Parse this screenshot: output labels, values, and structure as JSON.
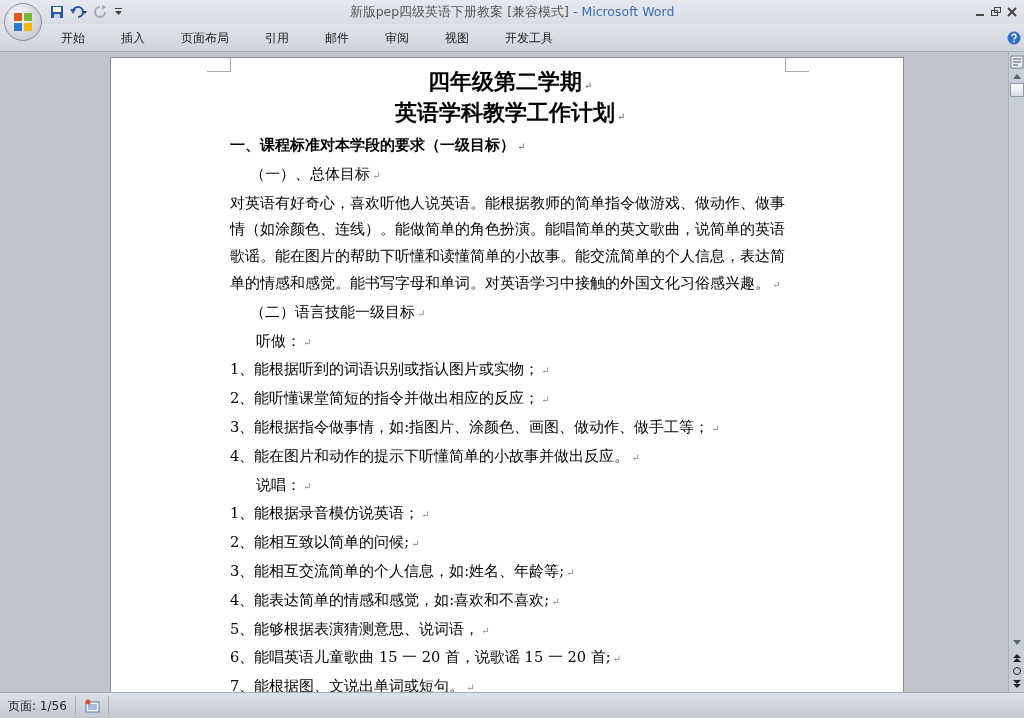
{
  "window": {
    "doc_title": "新版pep四级英语下册教案 [兼容模式]",
    "app_name": " - Microsoft Word"
  },
  "ribbon_tabs": [
    {
      "label": "开始",
      "selected": false
    },
    {
      "label": "插入",
      "selected": false
    },
    {
      "label": "页面布局",
      "selected": false
    },
    {
      "label": "引用",
      "selected": false
    },
    {
      "label": "邮件",
      "selected": false
    },
    {
      "label": "审阅",
      "selected": false
    },
    {
      "label": "视图",
      "selected": false
    },
    {
      "label": "开发工具",
      "selected": false
    }
  ],
  "document": {
    "title_lines": [
      {
        "text": "四年级第二学期",
        "mark": "↵"
      },
      {
        "text": "英语学科教学工作计划",
        "mark": "↵"
      }
    ],
    "paragraphs": [
      {
        "kind": "heading",
        "text": "一、课程标准对本学段的要求（一级目标）",
        "mark": "↵"
      },
      {
        "kind": "subheading",
        "text": "（一）、总体目标",
        "mark": "↵"
      },
      {
        "kind": "body",
        "text": "对英语有好奇心，喜欢听他人说英语。能根据教师的简单指令做游戏、做动作、做事情（如涂颜色、连线）。能做简单的角色扮演。能唱简单的英文歌曲，说简单的英语歌谣。能在图片的帮助下听懂和读懂简单的小故事。能交流简单的个人信息，表达简单的情感和感觉。能书写字母和单词。对英语学习中接触的外国文化习俗感兴趣。",
        "mark": "↵"
      },
      {
        "kind": "subheading",
        "text": "（二）语言技能一级目标",
        "mark": "↵"
      },
      {
        "kind": "label",
        "text": "听做：",
        "mark": "↵"
      },
      {
        "kind": "body",
        "text": "1、能根据听到的词语识别或指认图片或实物；",
        "mark": "↵"
      },
      {
        "kind": "body",
        "text": "2、能听懂课堂简短的指令并做出相应的反应；",
        "mark": "↵"
      },
      {
        "kind": "body",
        "text": "3、能根据指令做事情，如:指图片、涂颜色、画图、做动作、做手工等；",
        "mark": "↵"
      },
      {
        "kind": "body",
        "text": "4、能在图片和动作的提示下听懂简单的小故事并做出反应。",
        "mark": "↵"
      },
      {
        "kind": "label",
        "text": "说唱：",
        "mark": "↵"
      },
      {
        "kind": "body",
        "text": "1、能根据录音模仿说英语；",
        "mark": "↵"
      },
      {
        "kind": "body",
        "text": "2、能相互致以简单的问候;",
        "mark": "↵"
      },
      {
        "kind": "body",
        "text": "3、能相互交流简单的个人信息，如:姓名、年龄等;",
        "mark": "↵"
      },
      {
        "kind": "body",
        "text": "4、能表达简单的情感和感觉，如:喜欢和不喜欢;",
        "mark": "↵"
      },
      {
        "kind": "body",
        "text": "5、能够根据表演猜测意思、说词语，",
        "mark": "↵"
      },
      {
        "kind": "body",
        "text": "6、能唱英语儿童歌曲 15 一 20 首，说歌谣 15 一 20 首;",
        "mark": "↵"
      },
      {
        "kind": "body",
        "text": "7、能根据图、文说出单词或短句。",
        "mark": "↵"
      }
    ]
  },
  "status_bar": {
    "page": "页面: 1/56"
  }
}
